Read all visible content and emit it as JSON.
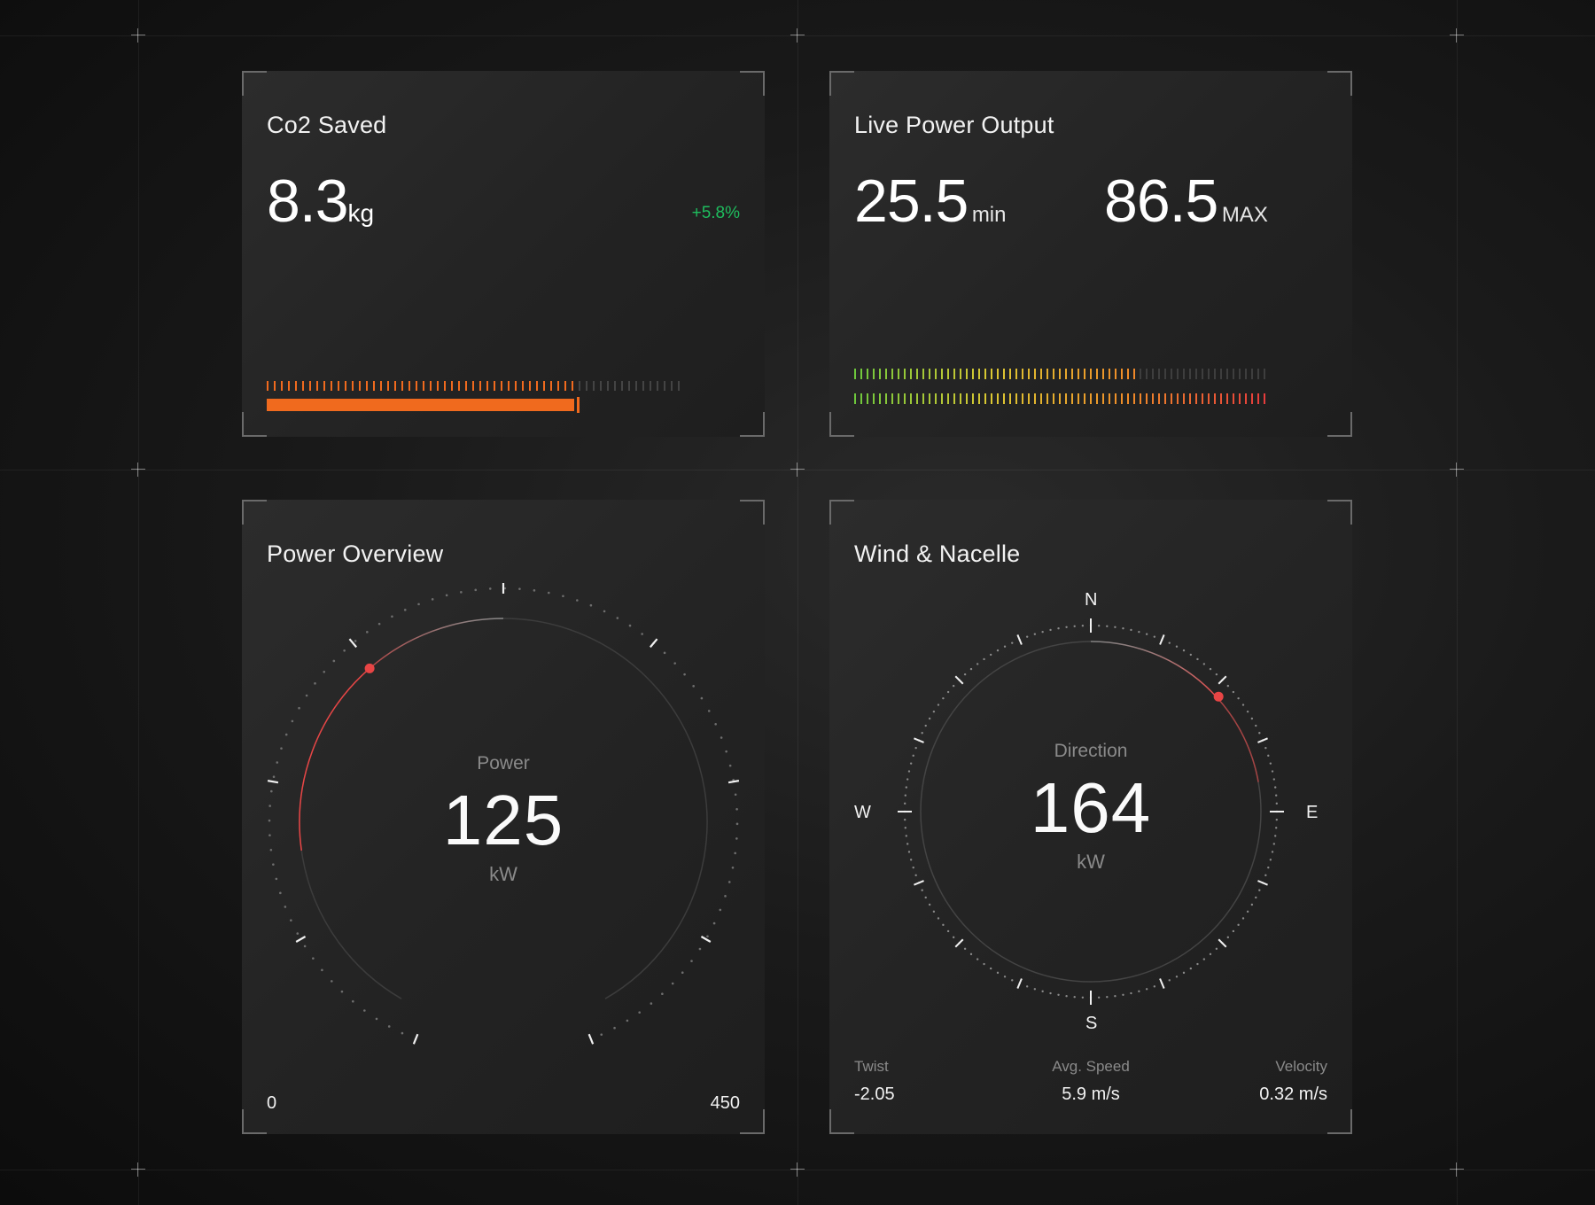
{
  "co2": {
    "title": "Co2 Saved",
    "value": "8.3",
    "unit": "kg",
    "change": "+5.8%",
    "progress": 0.75,
    "accent": "#f06a1e",
    "positive_color": "#1fbd5e"
  },
  "live_power": {
    "title": "Live Power Output",
    "min_value": "25.5",
    "min_label": "min",
    "max_value": "86.5",
    "max_label": "MAX",
    "min_level": 0.69,
    "max_level": 1.0
  },
  "power_overview": {
    "title": "Power Overview",
    "label": "Power",
    "value": "125",
    "unit": "kW",
    "range_min": "0",
    "range_max": "450",
    "indicator_color": "#e84545"
  },
  "wind": {
    "title": "Wind & Nacelle",
    "label": "Direction",
    "value": "164",
    "unit": "kW",
    "directions": {
      "n": "N",
      "e": "E",
      "s": "S",
      "w": "W"
    },
    "stats": [
      {
        "label": "Twist",
        "value": "-2.05"
      },
      {
        "label": "Avg. Speed",
        "value": "5.9 m/s"
      },
      {
        "label": "Velocity",
        "value": "0.32 m/s"
      }
    ]
  }
}
